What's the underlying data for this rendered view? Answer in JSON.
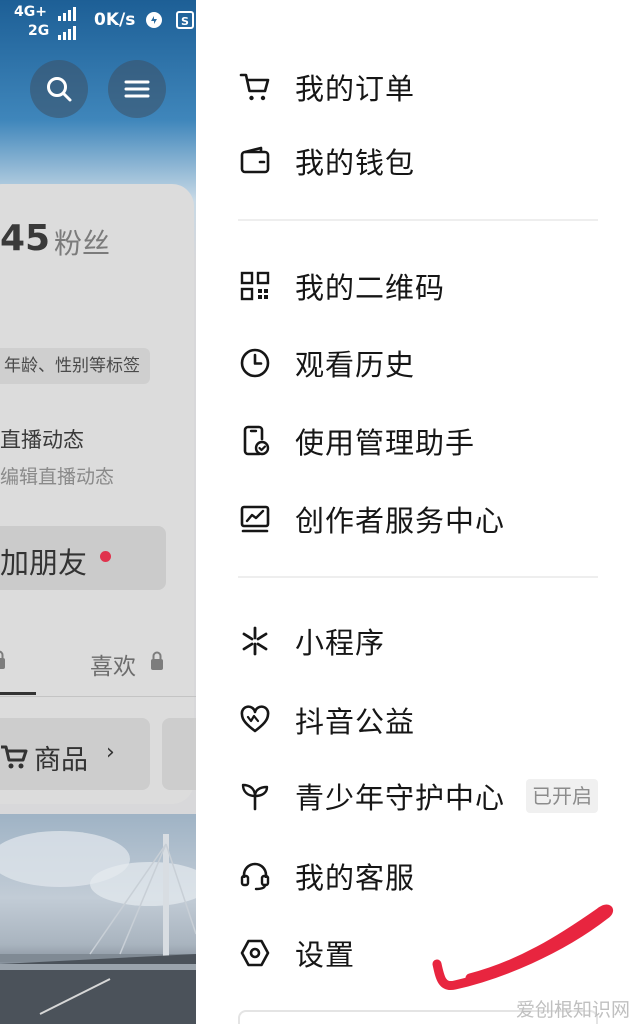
{
  "status_bar": {
    "network_top": "4G+",
    "network_bottom": "2G",
    "speed": "0K/s"
  },
  "profile": {
    "fans_count": "45",
    "fans_label": "粉丝",
    "tags_hint": "年龄、性别等标签",
    "live_title": "直播动态",
    "live_subtitle": "编辑直播动态",
    "add_friend": "加朋友",
    "tab_likes": "喜欢",
    "goods_label": "商品",
    "goods_chevron": "›"
  },
  "menu": {
    "group1": [
      {
        "label": "我的订单",
        "icon": "cart-icon"
      },
      {
        "label": "我的钱包",
        "icon": "wallet-icon"
      }
    ],
    "group2": [
      {
        "label": "我的二维码",
        "icon": "qrcode-icon"
      },
      {
        "label": "观看历史",
        "icon": "clock-icon"
      },
      {
        "label": "使用管理助手",
        "icon": "phone-check-icon"
      },
      {
        "label": "创作者服务中心",
        "icon": "monitor-chart-icon"
      }
    ],
    "group3": [
      {
        "label": "小程序",
        "icon": "asterisk-icon"
      },
      {
        "label": "抖音公益",
        "icon": "heart-icon"
      },
      {
        "label": "青少年守护中心",
        "icon": "sprout-icon",
        "badge": "已开启"
      },
      {
        "label": "我的客服",
        "icon": "headset-icon"
      },
      {
        "label": "设置",
        "icon": "hexagon-settings-icon"
      }
    ]
  },
  "annotation_color": "#e8253f",
  "watermark": "爱创根知识网"
}
